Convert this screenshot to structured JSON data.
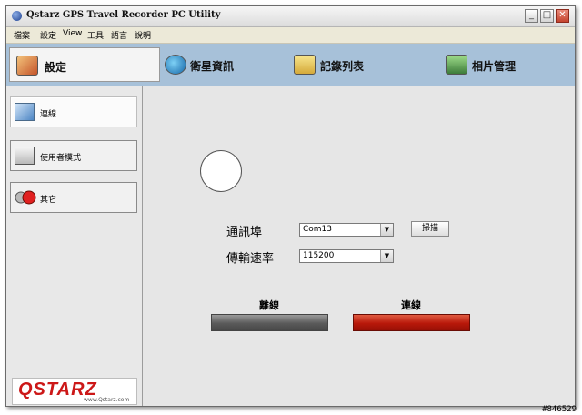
{
  "window": {
    "title": "Qstarz GPS Travel Recorder PC Utility",
    "controls": {
      "minimize": "_",
      "maximize": "□",
      "close": "✕"
    }
  },
  "menu": [
    "檔案",
    "設定",
    "View",
    "工具",
    "語言",
    "說明"
  ],
  "toolbar": {
    "tabs": [
      {
        "label": "設定",
        "icon": "settings-icon",
        "active": true
      },
      {
        "label": "衛星資訊",
        "icon": "satellite-icon",
        "active": false
      },
      {
        "label": "記錄列表",
        "icon": "log-list-icon",
        "active": false
      },
      {
        "label": "相片管理",
        "icon": "photo-manager-icon",
        "active": false
      }
    ]
  },
  "sidebar": {
    "items": [
      {
        "label": "連線",
        "icon": "connection-icon",
        "active": true
      },
      {
        "label": "使用者模式",
        "icon": "user-mode-icon",
        "active": false
      },
      {
        "label": "其它",
        "icon": "other-icon",
        "active": false
      }
    ],
    "logo": {
      "text": "QSTARZ",
      "url": "www.Qstarz.com"
    }
  },
  "connection": {
    "port_label": "通訊埠",
    "port_value": "Com13",
    "scan_label": "掃描",
    "baud_label": "傳輸速率",
    "baud_value": "115200",
    "disconnect_label": "離線",
    "connect_label": "連線"
  },
  "colors": {
    "toolbar_bg": "#a7c1d9",
    "connect_red": "#b8180a",
    "disconnect_gray": "#5a5a5a",
    "logo_red": "#cc1818"
  },
  "watermark": "#846529"
}
